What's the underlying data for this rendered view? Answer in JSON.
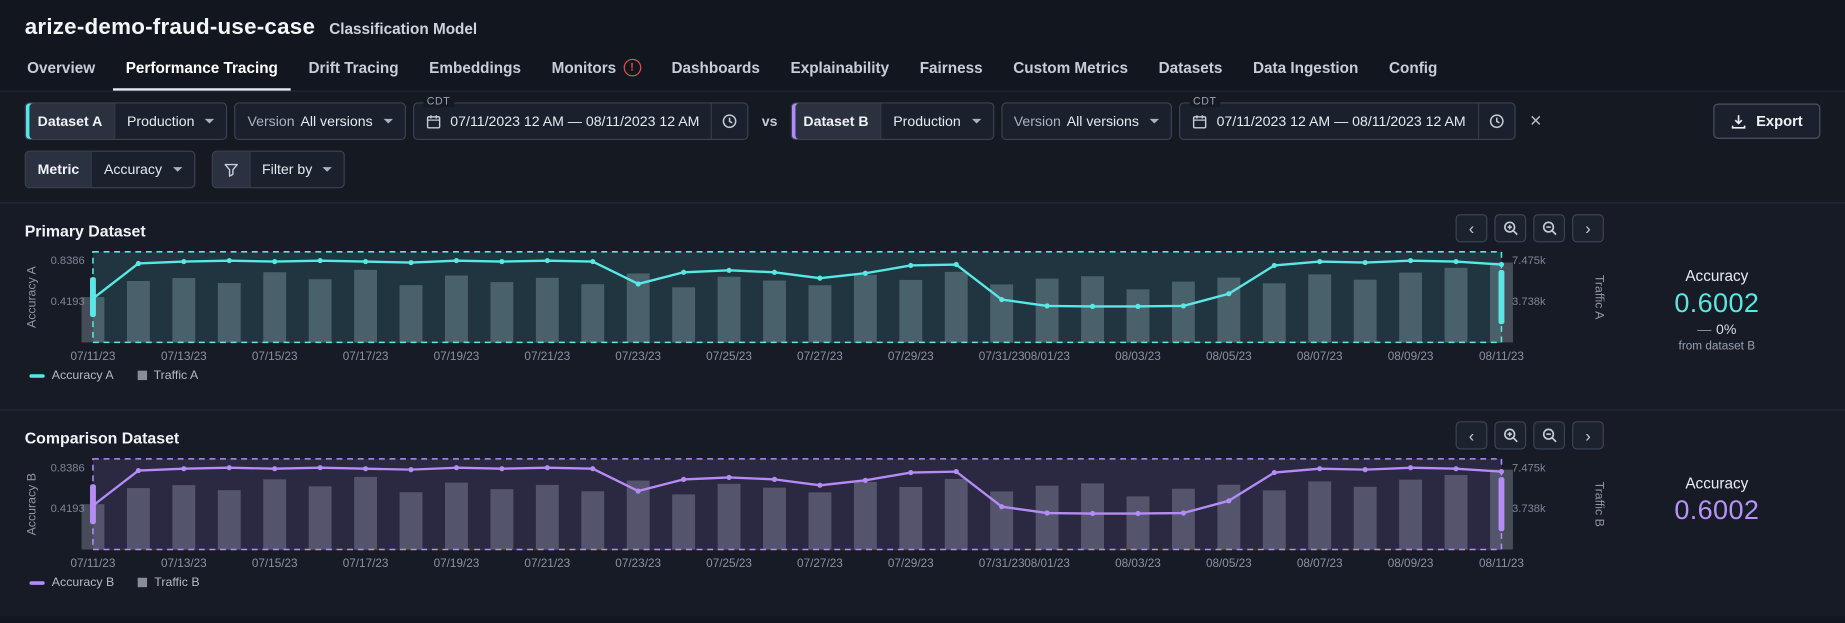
{
  "header": {
    "title": "arize-demo-fraud-use-case",
    "subtitle": "Classification Model"
  },
  "tabs": [
    {
      "label": "Overview"
    },
    {
      "label": "Performance Tracing",
      "active": true
    },
    {
      "label": "Drift Tracing"
    },
    {
      "label": "Embeddings"
    },
    {
      "label": "Monitors",
      "alert": true
    },
    {
      "label": "Dashboards"
    },
    {
      "label": "Explainability"
    },
    {
      "label": "Fairness"
    },
    {
      "label": "Custom Metrics"
    },
    {
      "label": "Datasets"
    },
    {
      "label": "Data Ingestion"
    },
    {
      "label": "Config"
    }
  ],
  "icons": {
    "prev": "‹",
    "next": "›",
    "close": "✕"
  },
  "filters": {
    "vs_label": "vs",
    "export_label": "Export",
    "metric_label": "Metric",
    "metric_value": "Accuracy",
    "filter_by_label": "Filter by",
    "dataset_a": {
      "label": "Dataset A",
      "environment": "Production",
      "version_label": "Version",
      "version": "All versions",
      "timezone": "CDT",
      "date_range": "07/11/2023 12 AM  —  08/11/2023 12 AM",
      "accent": "#56e7e3"
    },
    "dataset_b": {
      "label": "Dataset B",
      "environment": "Production",
      "version_label": "Version",
      "version": "All versions",
      "timezone": "CDT",
      "date_range": "07/11/2023 12 AM  —  08/11/2023 12 AM",
      "accent": "#b18cf4"
    }
  },
  "primary": {
    "title": "Primary Dataset",
    "stat": {
      "label": "Accuracy",
      "value": "0.6002",
      "delta_dash": "—",
      "delta_value": "0%",
      "delta_caption": "from dataset B"
    },
    "legend": [
      {
        "label": "Accuracy A",
        "type": "line",
        "color": "#59e8e5"
      },
      {
        "label": "Traffic A",
        "type": "bar",
        "color": "#9aa3ae"
      }
    ]
  },
  "comparison": {
    "title": "Comparison Dataset",
    "stat": {
      "label": "Accuracy",
      "value": "0.6002"
    },
    "legend": [
      {
        "label": "Accuracy B",
        "type": "line",
        "color": "#b58cf6"
      },
      {
        "label": "Traffic B",
        "type": "bar",
        "color": "#9aa3ae"
      }
    ]
  },
  "chart_data": [
    {
      "type": "line+bar",
      "section": "Primary Dataset",
      "accent": "#59e8e5",
      "days": 32,
      "x_ticks": [
        {
          "d": 0,
          "label": "07/11/23"
        },
        {
          "d": 2,
          "label": "07/13/23"
        },
        {
          "d": 4,
          "label": "07/15/23"
        },
        {
          "d": 6,
          "label": "07/17/23"
        },
        {
          "d": 8,
          "label": "07/19/23"
        },
        {
          "d": 10,
          "label": "07/21/23"
        },
        {
          "d": 12,
          "label": "07/23/23"
        },
        {
          "d": 14,
          "label": "07/25/23"
        },
        {
          "d": 16,
          "label": "07/27/23"
        },
        {
          "d": 18,
          "label": "07/29/23"
        },
        {
          "d": 20,
          "label": "07/31/23"
        },
        {
          "d": 21,
          "label": "08/01/23"
        },
        {
          "d": 23,
          "label": "08/03/23"
        },
        {
          "d": 25,
          "label": "08/05/23"
        },
        {
          "d": 27,
          "label": "08/07/23"
        },
        {
          "d": 29,
          "label": "08/09/23"
        },
        {
          "d": 31,
          "label": "08/11/23"
        }
      ],
      "left_axis": {
        "label": "Accuracy A",
        "min": 0,
        "max": 0.93,
        "ticks": [
          {
            "v": 0.8386,
            "label": "0.8386"
          },
          {
            "v": 0.4193,
            "label": "0.4193"
          }
        ]
      },
      "right_axis": {
        "label": "Traffic A",
        "min": 0,
        "max": 8290,
        "ticks": [
          {
            "v": 7475,
            "label": "7.475k"
          },
          {
            "v": 3738,
            "label": "3.738k"
          }
        ]
      },
      "brush": {
        "start_day": 0,
        "end_day": 31
      },
      "series": [
        {
          "name": "Accuracy A",
          "type": "line",
          "axis": "left",
          "color": "#59e8e5",
          "values": [
            0.45,
            0.81,
            0.83,
            0.84,
            0.83,
            0.84,
            0.83,
            0.82,
            0.84,
            0.83,
            0.84,
            0.83,
            0.6,
            0.72,
            0.74,
            0.72,
            0.66,
            0.71,
            0.79,
            0.8,
            0.44,
            0.375,
            0.37,
            0.37,
            0.375,
            0.5,
            0.79,
            0.83,
            0.82,
            0.84,
            0.83,
            0.8
          ]
        },
        {
          "name": "Traffic A",
          "type": "bar",
          "axis": "right",
          "color": "#97a0ac",
          "values": [
            4150,
            5620,
            5890,
            5430,
            6420,
            5780,
            6640,
            5240,
            6120,
            5520,
            5910,
            5330,
            6310,
            5040,
            6010,
            5660,
            5230,
            6190,
            5720,
            6460,
            5310,
            5840,
            6050,
            4860,
            5560,
            5930,
            5410,
            6230,
            5740,
            6390,
            6820,
            7310
          ]
        }
      ]
    },
    {
      "type": "line+bar",
      "section": "Comparison Dataset",
      "accent": "#b58cf6",
      "days": 32,
      "x_ticks": [
        {
          "d": 0,
          "label": "07/11/23"
        },
        {
          "d": 2,
          "label": "07/13/23"
        },
        {
          "d": 4,
          "label": "07/15/23"
        },
        {
          "d": 6,
          "label": "07/17/23"
        },
        {
          "d": 8,
          "label": "07/19/23"
        },
        {
          "d": 10,
          "label": "07/21/23"
        },
        {
          "d": 12,
          "label": "07/23/23"
        },
        {
          "d": 14,
          "label": "07/25/23"
        },
        {
          "d": 16,
          "label": "07/27/23"
        },
        {
          "d": 18,
          "label": "07/29/23"
        },
        {
          "d": 20,
          "label": "07/31/23"
        },
        {
          "d": 21,
          "label": "08/01/23"
        },
        {
          "d": 23,
          "label": "08/03/23"
        },
        {
          "d": 25,
          "label": "08/05/23"
        },
        {
          "d": 27,
          "label": "08/07/23"
        },
        {
          "d": 29,
          "label": "08/09/23"
        },
        {
          "d": 31,
          "label": "08/11/23"
        }
      ],
      "left_axis": {
        "label": "Accuracy B",
        "min": 0,
        "max": 0.93,
        "ticks": [
          {
            "v": 0.8386,
            "label": "0.8386"
          },
          {
            "v": 0.4193,
            "label": "0.4193"
          }
        ]
      },
      "right_axis": {
        "label": "Traffic B",
        "min": 0,
        "max": 8290,
        "ticks": [
          {
            "v": 7475,
            "label": "7.475k"
          },
          {
            "v": 3738,
            "label": "3.738k"
          }
        ]
      },
      "brush": {
        "start_day": 0,
        "end_day": 31
      },
      "series": [
        {
          "name": "Accuracy B",
          "type": "line",
          "axis": "left",
          "color": "#b58cf6",
          "values": [
            0.45,
            0.81,
            0.83,
            0.84,
            0.83,
            0.84,
            0.83,
            0.82,
            0.84,
            0.83,
            0.84,
            0.83,
            0.6,
            0.72,
            0.74,
            0.72,
            0.66,
            0.71,
            0.79,
            0.8,
            0.44,
            0.375,
            0.37,
            0.37,
            0.375,
            0.5,
            0.79,
            0.83,
            0.82,
            0.84,
            0.83,
            0.8
          ]
        },
        {
          "name": "Traffic B",
          "type": "bar",
          "axis": "right",
          "color": "#97a0ac",
          "values": [
            4150,
            5620,
            5890,
            5430,
            6420,
            5780,
            6640,
            5240,
            6120,
            5520,
            5910,
            5330,
            6310,
            5040,
            6010,
            5660,
            5230,
            6190,
            5720,
            6460,
            5310,
            5840,
            6050,
            4860,
            5560,
            5930,
            5410,
            6230,
            5740,
            6390,
            6820,
            7310
          ]
        }
      ]
    }
  ]
}
